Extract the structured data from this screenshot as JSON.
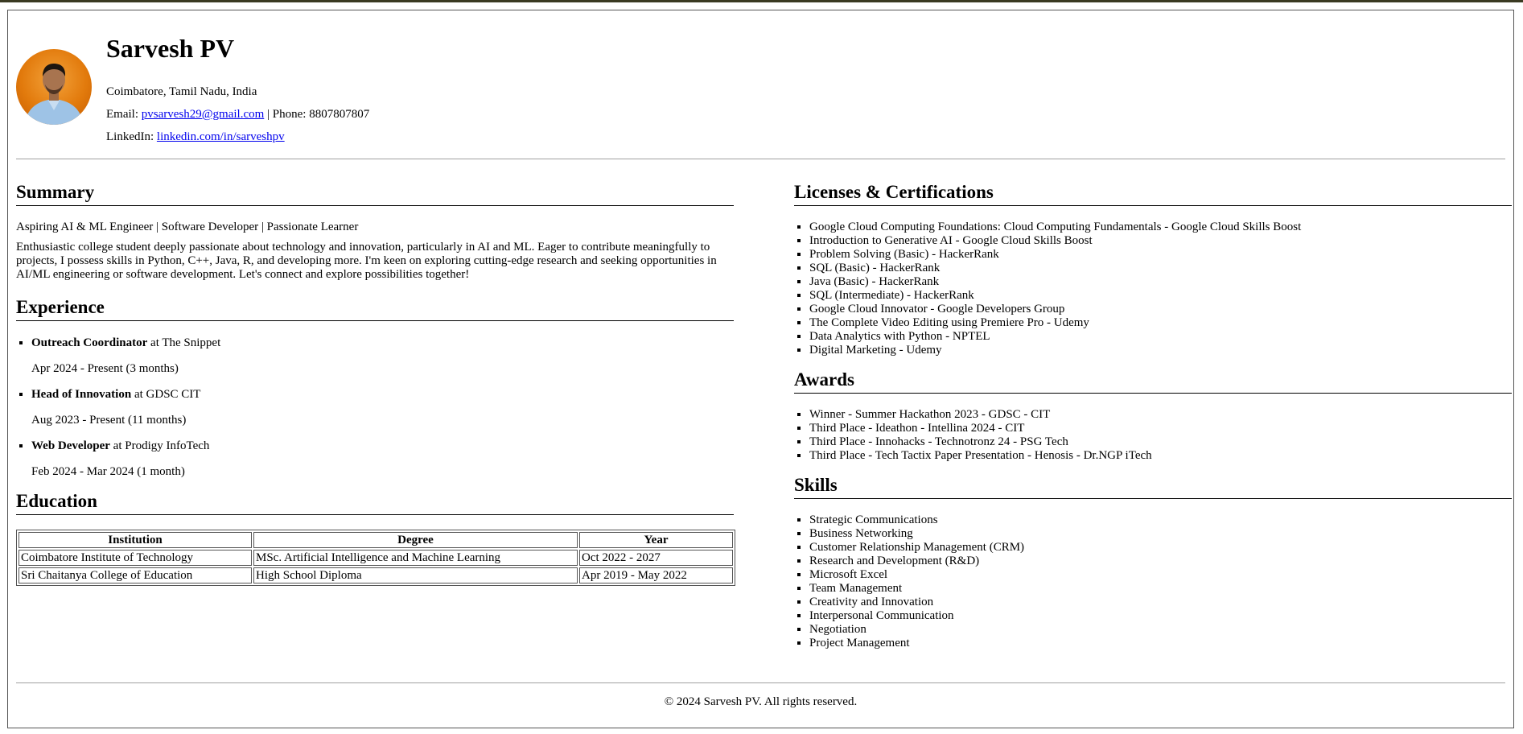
{
  "header": {
    "name": "Sarvesh PV",
    "location": "Coimbatore, Tamil Nadu, India",
    "email_label": "Email:",
    "email": "pvsarvesh29@gmail.com",
    "phone_sep": "| Phone: 8807807807",
    "linkedin_label": "LinkedIn:",
    "linkedin": "linkedin.com/in/sarveshpv"
  },
  "summary": {
    "heading": "Summary",
    "tagline": "Aspiring AI & ML Engineer | Software Developer | Passionate Learner",
    "body": "Enthusiastic college student deeply passionate about technology and innovation, particularly in AI and ML. Eager to contribute meaningfully to projects, I possess skills in Python, C++, Java, R, and developing more. I'm keen on exploring cutting-edge research and seeking opportunities in AI/ML engineering or software development. Let's connect and explore possibilities together!"
  },
  "experience": {
    "heading": "Experience",
    "items": [
      {
        "role": "Outreach Coordinator",
        "org": " at The Snippet",
        "dates": "Apr 2024 - Present (3 months)"
      },
      {
        "role": "Head of Innovation",
        "org": " at GDSC CIT",
        "dates": "Aug 2023 - Present (11 months)"
      },
      {
        "role": "Web Developer",
        "org": " at Prodigy InfoTech",
        "dates": "Feb 2024 - Mar 2024 (1 month)"
      }
    ]
  },
  "education": {
    "heading": "Education",
    "columns": [
      "Institution",
      "Degree",
      "Year"
    ],
    "rows": [
      [
        "Coimbatore Institute of Technology",
        "MSc. Artificial Intelligence and Machine Learning",
        "Oct 2022 - 2027"
      ],
      [
        "Sri Chaitanya College of Education",
        "High School Diploma",
        "Apr 2019 - May 2022"
      ]
    ]
  },
  "licenses": {
    "heading": "Licenses & Certifications",
    "items": [
      "Google Cloud Computing Foundations: Cloud Computing Fundamentals - Google Cloud Skills Boost",
      "Introduction to Generative AI - Google Cloud Skills Boost",
      "Problem Solving (Basic) - HackerRank",
      "SQL (Basic) - HackerRank",
      "Java (Basic) - HackerRank",
      "SQL (Intermediate) - HackerRank",
      "Google Cloud Innovator - Google Developers Group",
      "The Complete Video Editing using Premiere Pro - Udemy",
      "Data Analytics with Python - NPTEL",
      "Digital Marketing - Udemy"
    ]
  },
  "awards": {
    "heading": "Awards",
    "items": [
      "Winner - Summer Hackathon 2023 - GDSC - CIT",
      "Third Place - Ideathon - Intellina 2024 - CIT",
      "Third Place - Innohacks - Technotronz 24 - PSG Tech",
      "Third Place - Tech Tactix Paper Presentation - Henosis - Dr.NGP iTech"
    ]
  },
  "skills": {
    "heading": "Skills",
    "items": [
      "Strategic Communications",
      "Business Networking",
      "Customer Relationship Management (CRM)",
      "Research and Development (R&D)",
      "Microsoft Excel",
      "Team Management",
      "Creativity and Innovation",
      "Interpersonal Communication",
      "Negotiation",
      "Project Management"
    ]
  },
  "footer": {
    "text": "© 2024 Sarvesh PV. All rights reserved."
  }
}
